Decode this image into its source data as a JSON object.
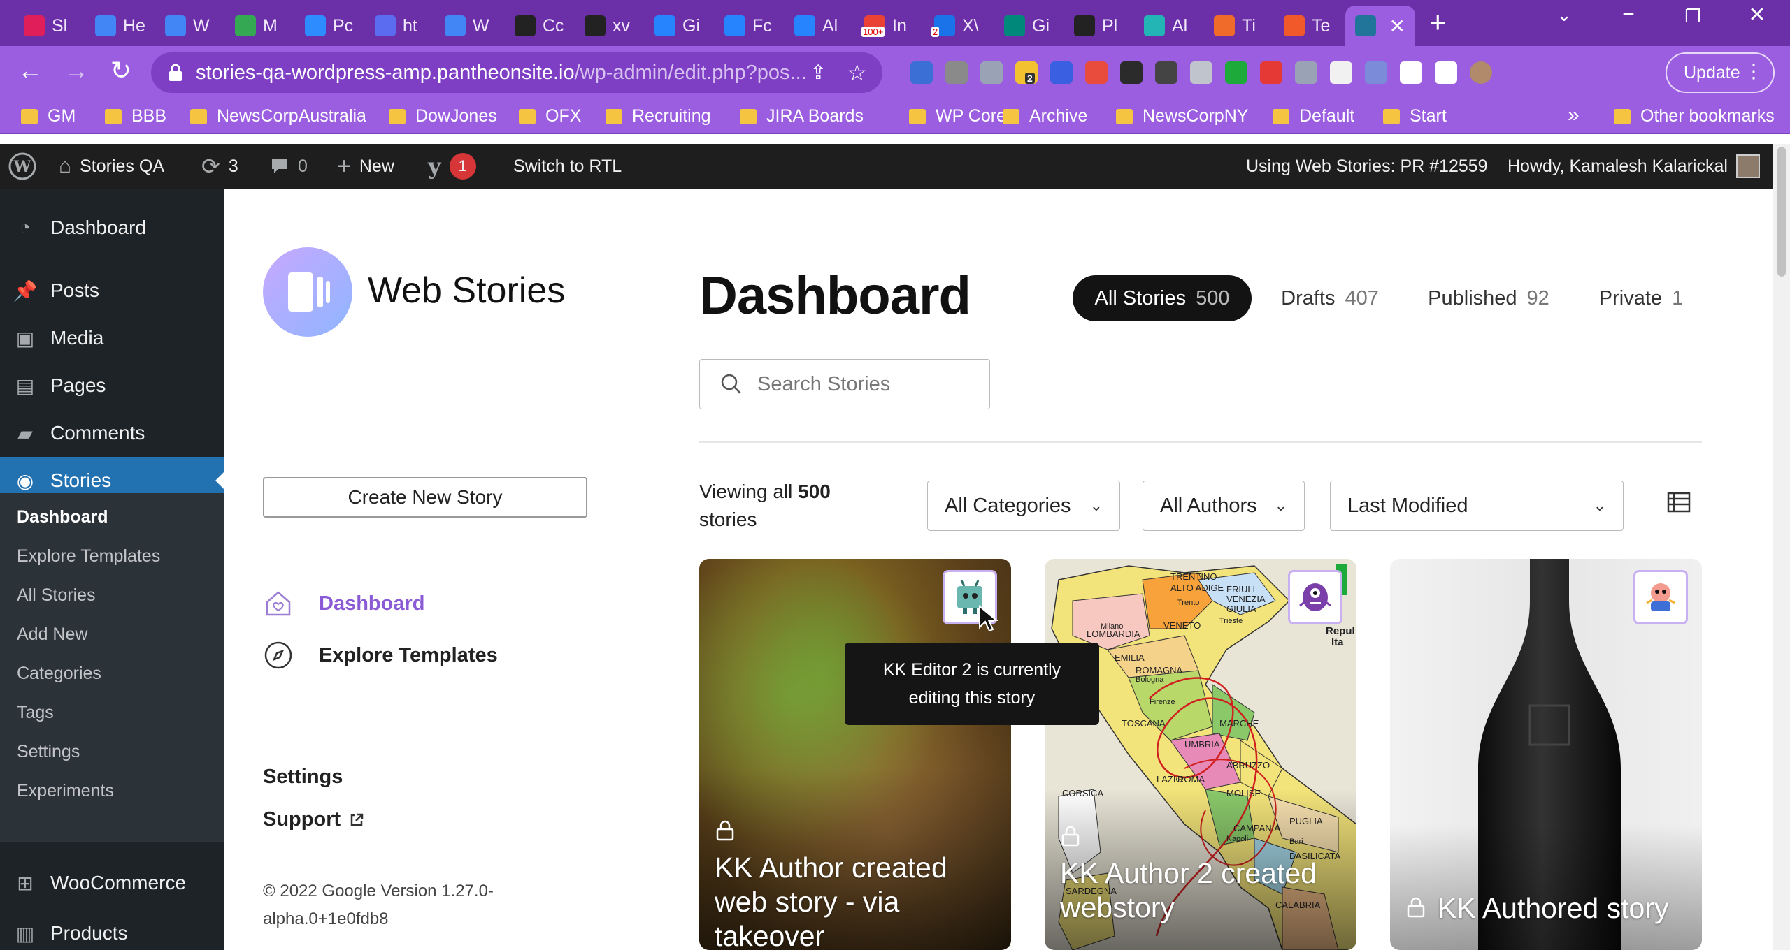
{
  "browser": {
    "tabs": [
      {
        "title": "Sl",
        "icon": "slack-icon",
        "color": "#e01e5a"
      },
      {
        "title": "He",
        "icon": "docs-icon",
        "color": "#4285f4"
      },
      {
        "title": "W",
        "icon": "docs-icon",
        "color": "#4285f4"
      },
      {
        "title": "M",
        "icon": "drive-icon",
        "color": "#34a853"
      },
      {
        "title": "Pc",
        "icon": "zoom-icon",
        "color": "#2d8cff"
      },
      {
        "title": "ht",
        "icon": "shield-check-icon",
        "color": "#5b6cf0"
      },
      {
        "title": "W",
        "icon": "docs-icon",
        "color": "#4285f4"
      },
      {
        "title": "Cc",
        "icon": "github-icon",
        "color": "#222222"
      },
      {
        "title": "xv",
        "icon": "github-icon",
        "color": "#222222"
      },
      {
        "title": "Gi",
        "icon": "jira-icon",
        "color": "#2684ff"
      },
      {
        "title": "Fc",
        "icon": "jira-icon",
        "color": "#2684ff"
      },
      {
        "title": "Al",
        "icon": "jira-icon",
        "color": "#2684ff"
      },
      {
        "title": "In",
        "icon": "gmail-icon",
        "color": "#ea4335",
        "badge": "100+"
      },
      {
        "title": "X\\",
        "icon": "calendar-icon",
        "color": "#1a73e8",
        "badge": "2"
      },
      {
        "title": "Gi",
        "icon": "meet-icon",
        "color": "#00897b"
      },
      {
        "title": "Pl",
        "icon": "pin-icon",
        "color": "#222222"
      },
      {
        "title": "Al",
        "icon": "asterisk-icon",
        "color": "#23b5b5"
      },
      {
        "title": "Ti",
        "icon": "chart-icon",
        "color": "#f06a2a"
      },
      {
        "title": "Te",
        "icon": "f-icon",
        "color": "#f1592a"
      },
      {
        "title": "",
        "icon": "wordpress-icon",
        "color": "#21759b",
        "active": true
      }
    ],
    "new_tab_label": "+",
    "address": {
      "host": "stories-qa-wordpress-amp.pantheonsite.io",
      "path": "/wp-admin/edit.php?pos..."
    },
    "update_label": "Update",
    "bookmarks": [
      "GM",
      "BBB",
      "NewsCorpAustralia",
      "DowJones",
      "OFX",
      "Recruiting",
      "JIRA Boards",
      "WP Core",
      "Archive",
      "NewsCorpNY",
      "Default",
      "Start"
    ],
    "bookmarks_more": "»",
    "other_bookmarks": "Other bookmarks",
    "extensions": [
      {
        "icon": "re-extension-icon",
        "color": "#3b6fd6"
      },
      {
        "icon": "w-extension-icon",
        "color": "#8a8a8a"
      },
      {
        "icon": "eraser-icon",
        "color": "#9aa3b5"
      },
      {
        "icon": "bulb-icon",
        "color": "#f2c230",
        "badge": "2"
      },
      {
        "icon": "d-extension-icon",
        "color": "#3a5fe0"
      },
      {
        "icon": "seo-icon",
        "color": "#e94b3c"
      },
      {
        "icon": "circle-dots-icon",
        "color": "#2b2b2b"
      },
      {
        "icon": "spy-icon",
        "color": "#444444"
      },
      {
        "icon": "image-icon",
        "color": "#c0c4cc"
      },
      {
        "icon": "green-square-icon",
        "color": "#1eaa3a"
      },
      {
        "icon": "hand-icon",
        "color": "#e53935"
      },
      {
        "icon": "bolt-icon",
        "color": "#9aa3b5"
      },
      {
        "icon": "ghost-icon",
        "color": "#f1f1f1"
      },
      {
        "icon": "g-extension-icon",
        "color": "#7b8bd9"
      },
      {
        "icon": "puzzle-icon",
        "color": "#ffffff"
      },
      {
        "icon": "sidepanel-icon",
        "color": "#ffffff"
      },
      {
        "icon": "profile-avatar-icon",
        "color": "#b08a6a"
      }
    ]
  },
  "adminbar": {
    "site_name": "Stories QA",
    "updates_count": "3",
    "comments_count": "0",
    "new_label": "New",
    "yoast_badge": "1",
    "rtl_label": "Switch to RTL",
    "using_label": "Using Web Stories: PR #12559",
    "howdy_label": "Howdy, Kamalesh Kalarickal"
  },
  "sidebar": {
    "items": [
      {
        "label": "Dashboard",
        "icon": "dashboard-icon"
      },
      {
        "label": "Posts",
        "icon": "pin-icon"
      },
      {
        "label": "Media",
        "icon": "media-icon"
      },
      {
        "label": "Pages",
        "icon": "pages-icon"
      },
      {
        "label": "Comments",
        "icon": "comment-icon"
      },
      {
        "label": "Stories",
        "icon": "stories-icon",
        "active": true
      }
    ],
    "submenu": [
      "Dashboard",
      "Explore Templates",
      "All Stories",
      "Add New",
      "Categories",
      "Tags",
      "Settings",
      "Experiments"
    ],
    "bottom": [
      {
        "label": "WooCommerce",
        "icon": "woo-icon"
      },
      {
        "label": "Products",
        "icon": "products-icon"
      }
    ]
  },
  "webstories": {
    "brand": "Web Stories",
    "create_label": "Create New Story",
    "nav": [
      {
        "label": "Dashboard",
        "icon": "home-heart-icon",
        "active": true
      },
      {
        "label": "Explore Templates",
        "icon": "compass-icon"
      }
    ],
    "settings_label": "Settings",
    "support_label": "Support",
    "footer_line1": "© 2022 Google Version 1.27.0-",
    "footer_line2": "alpha.0+1e0fdb8"
  },
  "dashboard": {
    "title": "Dashboard",
    "filters": [
      {
        "label": "All Stories",
        "count": "500",
        "active": true
      },
      {
        "label": "Drafts",
        "count": "407"
      },
      {
        "label": "Published",
        "count": "92"
      },
      {
        "label": "Private",
        "count": "1"
      }
    ],
    "search_placeholder": "Search Stories",
    "viewing_prefix": "Viewing all",
    "viewing_count": "500",
    "viewing_suffix": "stories",
    "category_select": "All Categories",
    "author_select": "All Authors",
    "sort_select": "Last Modified",
    "tooltip_line1": "KK Editor 2 is currently",
    "tooltip_line2": "editing this story",
    "cards": [
      {
        "title_line1": "KK Author created",
        "title_line2": "web story - via",
        "title_line3": "takeover"
      },
      {
        "title_line1": "KK Author 2 created",
        "title_line2": "webstory"
      },
      {
        "title_line1": "KK Authored story"
      }
    ],
    "map_labels": [
      "TRENTINO",
      "ALTO ADIGE",
      "FRIULI-",
      "VENEZIA",
      "GIULIA",
      "VENETO",
      "LOMBARDIA",
      "EMILIA",
      "ROMAGNA",
      "TOSCANA",
      "MARCHE",
      "UMBRIA",
      "ABRUZZO",
      "LAZIO",
      "ROMA",
      "MOLISE",
      "CAMPANIA",
      "PUGLIA",
      "BASILICATA",
      "CALABRIA",
      "SARDEGNA",
      "CORSICA",
      "Milano",
      "Trento",
      "Trieste",
      "Bologna",
      "Firenze",
      "Napoli",
      "Bari",
      "Repul",
      "Ita"
    ]
  }
}
